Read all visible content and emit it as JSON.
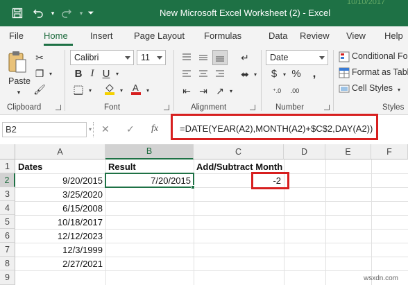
{
  "titlebar": {
    "title": "New Microsoft Excel Worksheet (2)  -  Excel",
    "background_date": "10/10/2017"
  },
  "tabs": [
    "File",
    "Home",
    "Insert",
    "Page Layout",
    "Formulas",
    "Data",
    "Review",
    "View",
    "Help"
  ],
  "active_tab": "Home",
  "ribbon": {
    "clipboard": {
      "paste": "Paste",
      "label": "Clipboard"
    },
    "font": {
      "name": "Calibri",
      "size": "11",
      "label": "Font"
    },
    "alignment": {
      "label": "Alignment"
    },
    "number": {
      "format": "Date",
      "label": "Number"
    },
    "styles": {
      "conditional_formatting": "Conditional For",
      "format_as_table": "Format as Table",
      "cell_styles": "Cell Styles",
      "label": "Styles"
    }
  },
  "formula_bar": {
    "name_box": "B2",
    "fx": "fx",
    "formula": "=DATE(YEAR(A2),MONTH(A2)+$C$2,DAY(A2))"
  },
  "sheet": {
    "columns": [
      "A",
      "B",
      "C",
      "D",
      "E",
      "F"
    ],
    "rows": [
      "1",
      "2",
      "3",
      "4",
      "5",
      "6",
      "7",
      "8",
      "9"
    ],
    "headers": {
      "a1": "Dates",
      "b1": "Result",
      "c1": "Add/Subtract Month"
    },
    "dates": [
      "9/20/2015",
      "3/25/2020",
      "6/15/2008",
      "10/18/2017",
      "12/12/2023",
      "12/3/1999",
      "2/27/2021"
    ],
    "result_b2": "7/20/2015",
    "months_c2": "-2",
    "selected_cell": "B2"
  },
  "watermark": "wsxdn.com",
  "colors": {
    "excel_green": "#1e7145",
    "highlight_red": "#d71f1f"
  }
}
